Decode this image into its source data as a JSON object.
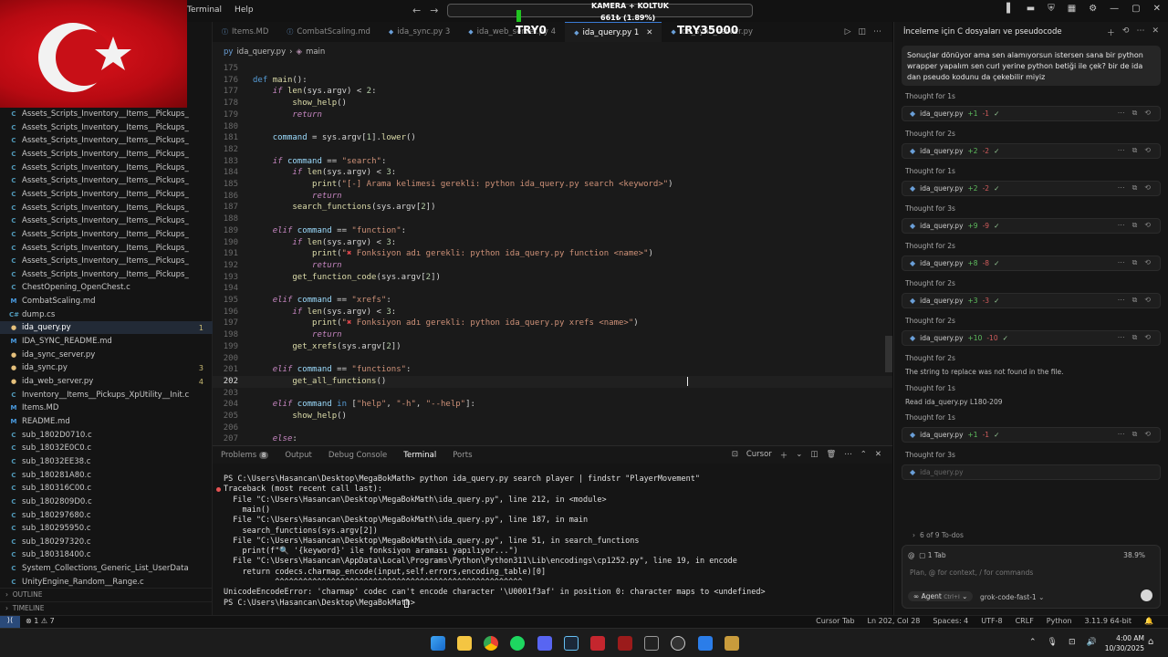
{
  "menu": [
    "Terminal",
    "Help"
  ],
  "overlay": {
    "cam_text": "KAMERA + KOLTUK",
    "bot_text": "661₺ (1.89%)",
    "try0": "TRY0",
    "try35000": "TRY35000"
  },
  "explorer": {
    "items": [
      {
        "icon": "C",
        "name": "Assets_Scripts_Inventory__Items__Pickups_Items_Item...",
        "badge": ""
      },
      {
        "icon": "C",
        "name": "Assets_Scripts_Inventory__Items__Pickups_Items_Item...",
        "badge": ""
      },
      {
        "icon": "C",
        "name": "Assets_Scripts_Inventory__Items__Pickups_Items_Item...",
        "badge": ""
      },
      {
        "icon": "C",
        "name": "Assets_Scripts_Inventory__Items__Pickups_Items_Item...",
        "badge": ""
      },
      {
        "icon": "C",
        "name": "Assets_Scripts_Inventory__Items__Pickups_Items_Item...",
        "badge": ""
      },
      {
        "icon": "C",
        "name": "Assets_Scripts_Inventory__Items__Pickups_Items_Item...",
        "badge": ""
      },
      {
        "icon": "C",
        "name": "Assets_Scripts_Inventory__Items__Pickups_Items_Item...",
        "badge": ""
      },
      {
        "icon": "C",
        "name": "Assets_Scripts_Inventory__Items__Pickups_Items_Item...",
        "badge": ""
      },
      {
        "icon": "C",
        "name": "Assets_Scripts_Inventory__Items__Pickups_Items_Item...",
        "badge": ""
      },
      {
        "icon": "C",
        "name": "Assets_Scripts_Inventory__Items__Pickups_Items_Item...",
        "badge": ""
      },
      {
        "icon": "C",
        "name": "Assets_Scripts_Inventory__Items__Pickups_Items_Item...",
        "badge": ""
      },
      {
        "icon": "C",
        "name": "Assets_Scripts_Inventory__Items__Pickups_Rarity__Cal...",
        "badge": ""
      },
      {
        "icon": "C",
        "name": "Assets_Scripts_Inventory__Items__Pickups_Rarity__Ge...",
        "badge": ""
      },
      {
        "icon": "C",
        "name": "ChestOpening_OpenChest.c",
        "badge": ""
      },
      {
        "icon": "M",
        "name": "CombatScaling.md",
        "badge": ""
      },
      {
        "icon": "C#",
        "name": "dump.cs",
        "badge": ""
      },
      {
        "icon": "py",
        "name": "ida_query.py",
        "badge": "1"
      },
      {
        "icon": "M",
        "name": "IDA_SYNC_README.md",
        "badge": ""
      },
      {
        "icon": "py",
        "name": "ida_sync_server.py",
        "badge": ""
      },
      {
        "icon": "py",
        "name": "ida_sync.py",
        "badge": "3"
      },
      {
        "icon": "py",
        "name": "ida_web_server.py",
        "badge": "4"
      },
      {
        "icon": "C",
        "name": "Inventory__Items__Pickups_XpUtility__Init.c",
        "badge": ""
      },
      {
        "icon": "M",
        "name": "Items.MD",
        "badge": ""
      },
      {
        "icon": "M",
        "name": "README.md",
        "badge": ""
      },
      {
        "icon": "C",
        "name": "sub_1802D0710.c",
        "badge": ""
      },
      {
        "icon": "C",
        "name": "sub_18032E0C0.c",
        "badge": ""
      },
      {
        "icon": "C",
        "name": "sub_18032EE38.c",
        "badge": ""
      },
      {
        "icon": "C",
        "name": "sub_180281A80.c",
        "badge": ""
      },
      {
        "icon": "C",
        "name": "sub_180316C00.c",
        "badge": ""
      },
      {
        "icon": "C",
        "name": "sub_1802809D0.c",
        "badge": ""
      },
      {
        "icon": "C",
        "name": "sub_180297680.c",
        "badge": ""
      },
      {
        "icon": "C",
        "name": "sub_180295950.c",
        "badge": ""
      },
      {
        "icon": "C",
        "name": "sub_180297320.c",
        "badge": ""
      },
      {
        "icon": "C",
        "name": "sub_180318400.c",
        "badge": ""
      },
      {
        "icon": "C",
        "name": "System_Collections_Generic_List_UserDataStore_Play...",
        "badge": ""
      },
      {
        "icon": "C",
        "name": "UnityEngine_Random__Range.c",
        "badge": ""
      }
    ],
    "outline": "OUTLINE",
    "timeline": "TIMELINE"
  },
  "tabs": [
    {
      "label": "Items.MD",
      "active": false
    },
    {
      "label": "CombatScaling.md",
      "active": false
    },
    {
      "label": "ida_sync.py 3",
      "active": false
    },
    {
      "label": "ida_web_server.py 4",
      "active": false
    },
    {
      "label": "ida_query.py 1",
      "active": true
    },
    {
      "label": "ida_sync_server.py",
      "active": false
    }
  ],
  "breadcrumb": {
    "file": "ida_query.py",
    "symbol": "main"
  },
  "code": [
    {
      "n": "175",
      "t": ""
    },
    {
      "n": "176",
      "t": "<span class='kd'>def</span> <span class='fn'>main</span><span class='pl'>():</span>"
    },
    {
      "n": "177",
      "t": "    <span class='kw'>if</span> <span class='fn'>len</span><span class='pl'>(sys.argv) &lt; </span><span class='nu'>2</span><span class='pl'>:</span>"
    },
    {
      "n": "178",
      "t": "        <span class='fn'>show_help</span><span class='pl'>()</span>"
    },
    {
      "n": "179",
      "t": "        <span class='kw'>return</span>"
    },
    {
      "n": "180",
      "t": ""
    },
    {
      "n": "181",
      "t": "    <span class='vr'>command</span><span class='pl'> = sys.argv[</span><span class='nu'>1</span><span class='pl'>].</span><span class='fn'>lower</span><span class='pl'>()</span>"
    },
    {
      "n": "182",
      "t": ""
    },
    {
      "n": "183",
      "t": "    <span class='kw'>if</span> <span class='vr'>command</span><span class='pl'> == </span><span class='st'>\"search\"</span><span class='pl'>:</span>"
    },
    {
      "n": "184",
      "t": "        <span class='kw'>if</span> <span class='fn'>len</span><span class='pl'>(sys.argv) &lt; </span><span class='nu'>3</span><span class='pl'>:</span>"
    },
    {
      "n": "185",
      "t": "            <span class='fn'>print</span><span class='pl'>(</span><span class='st'>\"[-] Arama kelimesi gerekli: python ida_query.py search &lt;keyword&gt;\"</span><span class='pl'>)</span>"
    },
    {
      "n": "186",
      "t": "            <span class='kw'>return</span>"
    },
    {
      "n": "187",
      "t": "        <span class='fn'>search_functions</span><span class='pl'>(sys.argv[</span><span class='nu'>2</span><span class='pl'>])</span>"
    },
    {
      "n": "188",
      "t": ""
    },
    {
      "n": "189",
      "t": "    <span class='kw'>elif</span> <span class='vr'>command</span><span class='pl'> == </span><span class='st'>\"function\"</span><span class='pl'>:</span>"
    },
    {
      "n": "190",
      "t": "        <span class='kw'>if</span> <span class='fn'>len</span><span class='pl'>(sys.argv) &lt; </span><span class='nu'>3</span><span class='pl'>:</span>"
    },
    {
      "n": "191",
      "t": "            <span class='fn'>print</span><span class='pl'>(</span><span class='st'>\"</span><span style='color:#e5484d'>✖</span><span class='st'> Fonksiyon adı gerekli: python ida_query.py function &lt;name&gt;\"</span><span class='pl'>)</span>"
    },
    {
      "n": "192",
      "t": "            <span class='kw'>return</span>"
    },
    {
      "n": "193",
      "t": "        <span class='fn'>get_function_code</span><span class='pl'>(sys.argv[</span><span class='nu'>2</span><span class='pl'>])</span>"
    },
    {
      "n": "194",
      "t": ""
    },
    {
      "n": "195",
      "t": "    <span class='kw'>elif</span> <span class='vr'>command</span><span class='pl'> == </span><span class='st'>\"xrefs\"</span><span class='pl'>:</span>"
    },
    {
      "n": "196",
      "t": "        <span class='kw'>if</span> <span class='fn'>len</span><span class='pl'>(sys.argv) &lt; </span><span class='nu'>3</span><span class='pl'>:</span>"
    },
    {
      "n": "197",
      "t": "            <span class='fn'>print</span><span class='pl'>(</span><span class='st'>\"</span><span style='color:#e5484d'>✖</span><span class='st'> Fonksiyon adı gerekli: python ida_query.py xrefs &lt;name&gt;\"</span><span class='pl'>)</span>"
    },
    {
      "n": "198",
      "t": "            <span class='kw'>return</span>"
    },
    {
      "n": "199",
      "t": "        <span class='fn'>get_xrefs</span><span class='pl'>(sys.argv[</span><span class='nu'>2</span><span class='pl'>])</span>"
    },
    {
      "n": "200",
      "t": ""
    },
    {
      "n": "201",
      "t": "    <span class='kw'>elif</span> <span class='vr'>command</span><span class='pl'> == </span><span class='st'>\"functions\"</span><span class='pl'>:</span>"
    },
    {
      "n": "202",
      "t": "        <span class='fn'>get_all_functions</span><span class='pl'>()</span>"
    },
    {
      "n": "203",
      "t": ""
    },
    {
      "n": "204",
      "t": "    <span class='kw'>elif</span> <span class='vr'>command</span> <span class='kd'>in</span><span class='pl'> [</span><span class='st'>\"help\"</span><span class='pl'>, </span><span class='st'>\"-h\"</span><span class='pl'>, </span><span class='st'>\"--help\"</span><span class='pl'>]:</span>"
    },
    {
      "n": "205",
      "t": "        <span class='fn'>show_help</span><span class='pl'>()</span>"
    },
    {
      "n": "206",
      "t": ""
    },
    {
      "n": "207",
      "t": "    <span class='kw'>else</span><span class='pl'>:</span>"
    }
  ],
  "current_line": "202",
  "panel": {
    "tabs": [
      "Problems",
      "Output",
      "Debug Console",
      "Terminal",
      "Ports"
    ],
    "problems_count": "8",
    "active": "Terminal",
    "shell_label": "Cursor"
  },
  "terminal_lines": [
    {
      "text": "PS C:\\Users\\Hasancan\\Desktop\\MegaBokMath> python ida_query.py search player | findstr \"PlayerMovement\"",
      "err": false
    },
    {
      "text": "Traceback (most recent call last):",
      "err": true
    },
    {
      "text": "  File \"C:\\Users\\Hasancan\\Desktop\\MegaBokMath\\ida_query.py\", line 212, in <module>",
      "err": false
    },
    {
      "text": "    main()",
      "err": false
    },
    {
      "text": "  File \"C:\\Users\\Hasancan\\Desktop\\MegaBokMath\\ida_query.py\", line 187, in main",
      "err": false
    },
    {
      "text": "    search_functions(sys.argv[2])",
      "err": false
    },
    {
      "text": "  File \"C:\\Users\\Hasancan\\Desktop\\MegaBokMath\\ida_query.py\", line 51, in search_functions",
      "err": false
    },
    {
      "text": "    print(f\"🔍 '{keyword}' ile fonksiyon araması yapılıyor...\")",
      "err": false
    },
    {
      "text": "  File \"C:\\Users\\Hasancan\\AppData\\Local\\Programs\\Python\\Python311\\Lib\\encodings\\cp1252.py\", line 19, in encode",
      "err": false
    },
    {
      "text": "    return codecs.charmap_encode(input,self.errors,encoding_table)[0]",
      "err": false
    },
    {
      "text": "           ^^^^^^^^^^^^^^^^^^^^^^^^^^^^^^^^^^^^^^^^^^^^^^^^^^^^^",
      "err": false
    },
    {
      "text": "UnicodeEncodeError: 'charmap' codec can't encode character '\\U0001f3af' in position 0: character maps to <undefined>",
      "err": false
    },
    {
      "text": "PS C:\\Users\\Hasancan\\Desktop\\MegaBokMath> ",
      "err": false
    }
  ],
  "chat": {
    "title": "İnceleme için C dosyaları ve pseudocode",
    "prompt": "Sonuçlar dönüyor ama sen alamıyorsun istersen sana bir python wrapper yapalım sen curl yerine python betiği ile çek? bir de ida dan pseudo kodunu da çekebilir miyiz",
    "entries": [
      {
        "kind": "thought",
        "text": "Thought for 1s"
      },
      {
        "kind": "file",
        "name": "ida_query.py",
        "add": "+1",
        "del": "-1"
      },
      {
        "kind": "thought",
        "text": "Thought for 2s"
      },
      {
        "kind": "file",
        "name": "ida_query.py",
        "add": "+2",
        "del": "-2"
      },
      {
        "kind": "thought",
        "text": "Thought for 1s"
      },
      {
        "kind": "file",
        "name": "ida_query.py",
        "add": "+2",
        "del": "-2"
      },
      {
        "kind": "thought",
        "text": "Thought for 3s"
      },
      {
        "kind": "file",
        "name": "ida_query.py",
        "add": "+9",
        "del": "-9"
      },
      {
        "kind": "thought",
        "text": "Thought for 2s"
      },
      {
        "kind": "file",
        "name": "ida_query.py",
        "add": "+8",
        "del": "-8"
      },
      {
        "kind": "thought",
        "text": "Thought for 2s"
      },
      {
        "kind": "file",
        "name": "ida_query.py",
        "add": "+3",
        "del": "-3"
      },
      {
        "kind": "thought",
        "text": "Thought for 2s"
      },
      {
        "kind": "file",
        "name": "ida_query.py",
        "add": "+10",
        "del": "-10"
      },
      {
        "kind": "thought",
        "text": "Thought for 2s"
      },
      {
        "kind": "plain",
        "text": "The string to replace was not found in the file."
      },
      {
        "kind": "thought",
        "text": "Thought for 1s"
      },
      {
        "kind": "plain",
        "text": "Read ida_query.py L180-209"
      },
      {
        "kind": "thought",
        "text": "Thought for 1s"
      },
      {
        "kind": "file",
        "name": "ida_query.py",
        "add": "+1",
        "del": "-1"
      },
      {
        "kind": "thought",
        "text": "Thought for 3s"
      },
      {
        "kind": "pending",
        "name": "ida_query.py"
      }
    ],
    "todos": "6 of 9 To-dos",
    "tab_count": "1 Tab",
    "context_pct": "38.9%",
    "placeholder": "Plan, @ for context, / for commands",
    "agent_label": "Agent",
    "agent_shortcut": "Ctrl+I",
    "model": "grok-code-fast-1"
  },
  "status": {
    "errors": "1",
    "warnings": "7",
    "cursor_tab": "Cursor Tab",
    "position": "Ln 202, Col 28",
    "spaces": "Spaces: 4",
    "encoding": "UTF-8",
    "eol": "CRLF",
    "language": "Python",
    "python_version": "3.11.9 64-bit"
  },
  "clock": {
    "time": "4:00 AM",
    "date": "10/30/2025"
  },
  "colors": {
    "accent": "#3a7bd5",
    "flag_red": "#e0141c",
    "add_green": "#5fbf5f",
    "del_red": "#d15c5c"
  }
}
